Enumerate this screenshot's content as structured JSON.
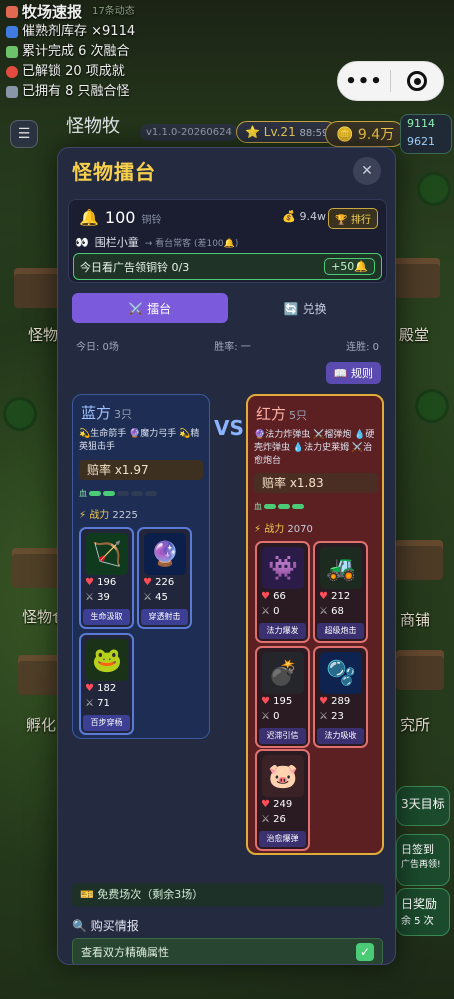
{
  "ticker": {
    "title": "牧场速报",
    "subtitle": "17条动态",
    "lines": [
      "催熟剂库存 ×9114",
      "累计完成 6 次融合",
      "已解锁 20 项成就",
      "已拥有 8 只融合怪"
    ]
  },
  "capsule": {
    "more": "•••",
    "target_icon": "record-icon"
  },
  "topbar": {
    "menu": "☰",
    "title": "怪物牧",
    "version": "v1.1.0-20260624",
    "level": "Lv.21",
    "level_sub": "88:59",
    "coins": "9.4万",
    "res_green": "9114",
    "res_blue": "9621"
  },
  "background_labels": [
    "怪物",
    "殿堂",
    "怪物仓",
    "商铺",
    "孵化",
    "究所",
    "3天目标",
    "日签到",
    "广告再领!",
    "日奖励",
    "余 5 次"
  ],
  "modal": {
    "title": "怪物擂台",
    "close": "✕",
    "bell": {
      "value": "100",
      "unit": "铜铃",
      "bag": "9.4w",
      "rank": "排行"
    },
    "crowd": {
      "label": "围栏小童",
      "hint": "→ 看台常客 (差100🔔)"
    },
    "ad": {
      "label": "今日看广告领铜铃 0/3",
      "btn": "+50🔔"
    },
    "tabs": [
      {
        "label": "⚔️ 擂台",
        "active": true
      },
      {
        "label": "🔄 兑换",
        "active": false
      }
    ],
    "stats": {
      "today": "今日: 0场",
      "winrate": "胜率: 一",
      "streak": "连胜: 0"
    },
    "rules": "📖 规则",
    "vs": "VS",
    "blue": {
      "name": "蓝方",
      "count": "3只",
      "traits": "💫生命箭手 🔮魔力弓手 💫精英狙击手",
      "odds": "赔率 x1.97",
      "hp_label": "血",
      "hp_filled": 2,
      "hp_total": 5,
      "power_label": "⚡ 战力",
      "power": "2225",
      "cards": [
        {
          "hp": "196",
          "atk": "39",
          "skill": "生命汲取",
          "emoji": "🏹",
          "bg": "#0f3a1e"
        },
        {
          "hp": "226",
          "atk": "45",
          "skill": "穿透射击",
          "emoji": "🔮",
          "bg": "#0b1f4a"
        },
        {
          "hp": "182",
          "atk": "71",
          "skill": "百步穿杨",
          "emoji": "🐸",
          "bg": "#1a3318"
        }
      ]
    },
    "red": {
      "name": "红方",
      "count": "5只",
      "traits": "🔮法力炸弹虫 ⚔️榴弹炮 💧硬壳炸弹虫 💧法力史莱姆 ⚔️治愈炮台",
      "odds": "赔率 x1.83",
      "hp_label": "血",
      "hp_filled": 3,
      "hp_total": 3,
      "power_label": "⚡ 战力",
      "power": "2070",
      "cards": [
        {
          "hp": "66",
          "atk": "0",
          "skill": "法力爆发",
          "emoji": "👾",
          "bg": "#2a1b48"
        },
        {
          "hp": "212",
          "atk": "68",
          "skill": "超级炮击",
          "emoji": "🚜",
          "bg": "#1c2a20"
        },
        {
          "hp": "195",
          "atk": "0",
          "skill": "迟滞引信",
          "emoji": "💣",
          "bg": "#25252c"
        },
        {
          "hp": "289",
          "atk": "23",
          "skill": "法力吸收",
          "emoji": "🫧",
          "bg": "#0e2350"
        },
        {
          "hp": "249",
          "atk": "26",
          "skill": "治愈爆弹",
          "emoji": "🐷",
          "bg": "#3a2226"
        }
      ]
    },
    "free": "🎫 免费场次（剩余3场）",
    "buy": "🔍 购买情报",
    "check": {
      "label": "查看双方精确属性",
      "mark": "✓"
    }
  }
}
